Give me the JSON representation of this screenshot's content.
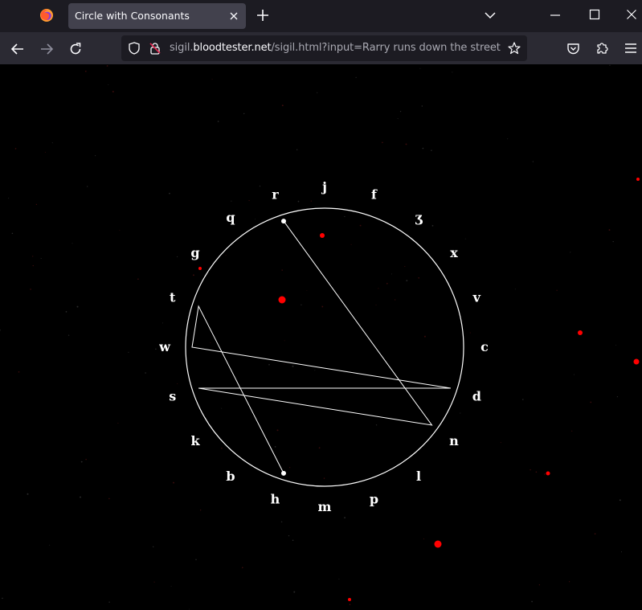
{
  "browser": {
    "tab_title": "Circle with Consonants",
    "url_prefix": "sigil.",
    "url_domain": "bloodtester.net",
    "url_path": "/sigil.html?input=Rarry runs down the street"
  },
  "sigil": {
    "letters": [
      "j",
      "f",
      "ʒ",
      "x",
      "v",
      "c",
      "d",
      "n",
      "l",
      "p",
      "m",
      "h",
      "b",
      "k",
      "s",
      "w",
      "t",
      "g",
      "q",
      "r"
    ],
    "path_letters": [
      "r",
      "n",
      "s",
      "d",
      "w",
      "t",
      "h"
    ],
    "colors": {
      "line": "#ffffff",
      "dot": "#ff0000",
      "background": "#000000"
    }
  }
}
